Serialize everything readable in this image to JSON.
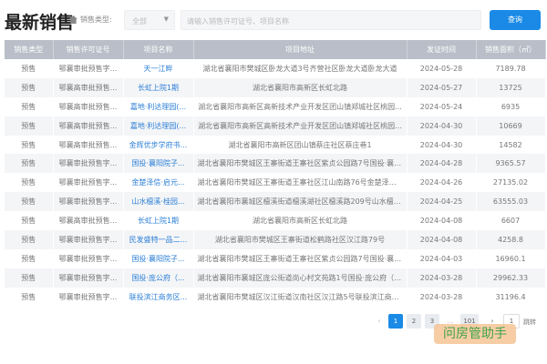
{
  "header": {
    "title": "最新销售",
    "filter_label": "销售类型:",
    "select_value": "全部",
    "search_placeholder": "请输入销售许可证号、项目名称",
    "search_button": "查询"
  },
  "table": {
    "columns": [
      "销售类型",
      "销售许可证号",
      "项目名称",
      "项目地址",
      "发证时间",
      "销售面积（㎡）"
    ],
    "rows": [
      [
        "预售",
        "鄂襄审批预售字...",
        "天一江畔",
        "湖北省襄阳市樊城区卧龙大道3号齐营社区卧龙大道卧龙大道",
        "2024-05-28",
        "7189.78"
      ],
      [
        "预售",
        "鄂襄高审批预售...",
        "长虹上院1期",
        "湖北省襄阳市高新区长虹北路",
        "2024-05-27",
        "13725"
      ],
      [
        "预售",
        "鄂襄高审批预售...",
        "嘉地·利达理园(...",
        "湖北省襄阳市高新区高新技术产业开发区团山镇郑城社区桃园...",
        "2024-05-24",
        "6935"
      ],
      [
        "预售",
        "鄂襄高审批预售...",
        "嘉地·利达理园(...",
        "湖北省襄阳市高新区高新技术产业开发区团山镇郑城社区桃园...",
        "2024-04-30",
        "10669"
      ],
      [
        "预售",
        "鄂襄高审批预售...",
        "金辉优步学府书...",
        "湖北省襄阳市高新区团山镇蔡庄社区蔡庄巷1",
        "2024-04-30",
        "14582"
      ],
      [
        "预售",
        "鄂襄审批预售字...",
        "国投·襄阳院子...",
        "湖北省襄阳市樊城区王寨街道王寨社区紫贞公园路7号国投·襄阳...",
        "2024-04-28",
        "9365.57"
      ],
      [
        "预售",
        "鄂襄审批预售字...",
        "金楚泽信·启元...",
        "湖北省襄阳市樊城区王寨街道王寨社区江山南路76号金楚泽信-...",
        "2024-04-26",
        "27135.02"
      ],
      [
        "预售",
        "鄂襄审批预售字...",
        "山水檀溪·桂园...",
        "湖北省襄阳市襄城区檀溪街道檀溪湖社区檀溪路209号山水檀溪...",
        "2024-04-25",
        "63555.03"
      ],
      [
        "预售",
        "鄂襄高审批预售...",
        "长虹上院1期",
        "湖北省襄阳市高新区长虹北路",
        "2024-04-08",
        "6607"
      ],
      [
        "预售",
        "鄂襄审批预售字...",
        "民发盛特一品二...",
        "湖北省襄阳市樊城区王寨街道松鹤路社区汉江路79号",
        "2024-04-08",
        "4258.8"
      ],
      [
        "预售",
        "鄂襄审批预售字...",
        "国投·襄阳院子...",
        "湖北省襄阳市樊城区王寨街道王寨社区紫贞公园路7号国投·襄阳...",
        "2024-04-03",
        "16960.1"
      ],
      [
        "预售",
        "鄂襄审批预售字...",
        "国投·庞公府（...",
        "湖北省襄阳市襄城区庞公街道尚心村文苑路1号国投·庞公府（南...",
        "2024-03-28",
        "29962.33"
      ],
      [
        "预售",
        "鄂襄审批预售字...",
        "联投滨江商务区...",
        "湖北省襄阳市樊城区汉江街道汉南社区汉江路5号联投滨江商务区",
        "2024-03-28",
        "31196.4"
      ]
    ]
  },
  "pagination": {
    "prev": "‹",
    "pages": [
      "1",
      "2",
      "3"
    ],
    "ellipsis": "...",
    "last": "101",
    "next": "›",
    "jump_value": "1",
    "jump_label": "跳转",
    "current": 1
  },
  "watermark": "问房管助手",
  "colors": {
    "accent": "#1a8ae6",
    "header_bg": "#b9bec8",
    "link": "#2c7fd6"
  }
}
